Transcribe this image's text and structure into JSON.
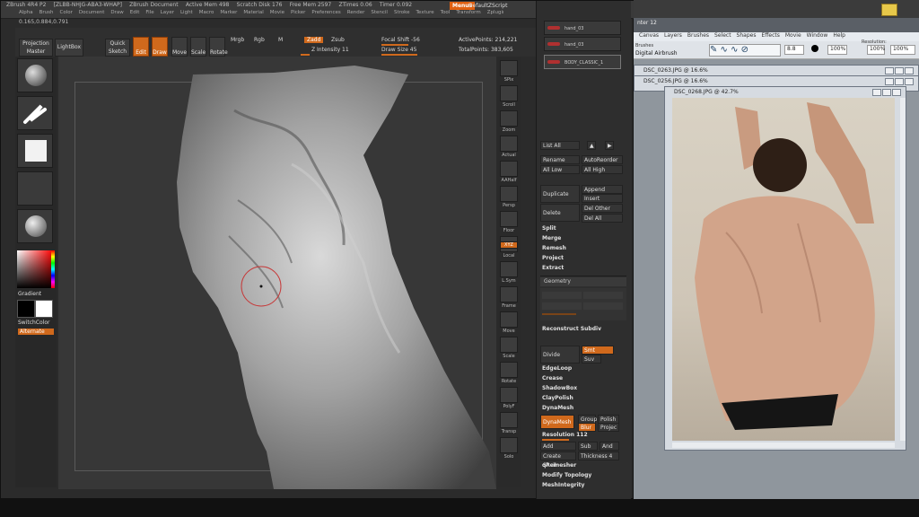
{
  "zbrush": {
    "title_bar": {
      "app": "ZBrush 4R4 P2",
      "id": "[ZLBB-NHJG-ABA3-WHAP]",
      "doc": "ZBrush Document",
      "active_mem": "Active Mem 498",
      "scratch": "Scratch Disk 176",
      "free_mem": "Free Mem 2597",
      "ztimes": "ZTimes 0.06",
      "timer": "Timer 0.092",
      "memo": "Menus",
      "script": "DefaultZScript"
    },
    "menus": [
      "Alpha",
      "Brush",
      "Color",
      "Document",
      "Draw",
      "Edit",
      "File",
      "Layer",
      "Light",
      "Macro",
      "Marker",
      "Material",
      "Movie",
      "Picker",
      "Preferences",
      "Render",
      "Stencil",
      "Stroke",
      "Texture",
      "Tool",
      "Transform",
      "Zplugin",
      "Zscript"
    ],
    "coords": "0.165,0.884,0.791",
    "toolbar": {
      "projection_master": "Projection Master",
      "lightbox": "LightBox",
      "quick_sketch": "Quick Sketch",
      "edit": "Edit",
      "draw": "Draw",
      "move": "Move",
      "scale": "Scale",
      "rotate": "Rotate",
      "mrgb": "Mrgb",
      "rgb": "Rgb",
      "m": "M",
      "zadd": "Zadd",
      "zsub": "Zsub",
      "z_intensity": "Z Intensity 11",
      "focal_shift": "Focal Shift -56",
      "draw_size": "Draw Size 45",
      "active_points": "ActivePoints: 214,221",
      "total_points": "TotalPoints: 383,605"
    },
    "left": {
      "gradient": "Gradient",
      "switch_color": "SwitchColor",
      "alternate": "Alternate"
    },
    "shelf": [
      "SPix",
      "Scroll",
      "Zoom",
      "Actual",
      "AAHalf",
      "Persp",
      "Floor",
      "Local",
      "L.Sym",
      "Frame",
      "Move",
      "Scale",
      "Rotate",
      "PolyF",
      "Transp",
      "Solo"
    ],
    "shelf_xyz": "XYZ",
    "subtools": [
      {
        "label": "hand_03"
      },
      {
        "label": "hand_03"
      },
      {
        "label": "BODY_CLASSIC_1"
      }
    ],
    "tray": {
      "list_all": "List All",
      "rename": "Rename",
      "auto_reorder": "AutoReorder",
      "all_low": "All Low",
      "all_high": "All High",
      "duplicate": "Duplicate",
      "append": "Append",
      "insert": "Insert",
      "delete": "Delete",
      "del_other": "Del Other",
      "del_all": "Del All",
      "split": "Split",
      "merge": "Merge",
      "remesh": "Remesh",
      "project": "Project",
      "extract": "Extract",
      "geometry": "Geometry",
      "reconstruct_subdiv": "Reconstruct Subdiv",
      "divide": "Divide",
      "smt": "Smt",
      "suv": "Suv",
      "edge_loop": "EdgeLoop",
      "crease": "Crease",
      "shadowbox": "ShadowBox",
      "claypolish": "ClayPolish",
      "dynamesh_title": "DynaMesh",
      "dynamesh_btn": "DynaMesh",
      "group": "Group",
      "polish": "Polish",
      "blur": "Blur",
      "projec": "Projec",
      "resolution": "Resolution 112",
      "add": "Add",
      "sub": "Sub",
      "and": "And",
      "create_shell": "Create Shell",
      "thickness": "Thickness 4",
      "qremesher": "qRemesher",
      "modify_topology": "Modify Topology",
      "meshintegrity": "MeshIntegrity"
    }
  },
  "photoshop": {
    "menus": [
      "Canvas",
      "Layers",
      "Brushes",
      "Select",
      "Shapes",
      "Effects",
      "Movie",
      "Window",
      "Help"
    ],
    "brush_label": "Brushes",
    "brush_name": "Digital Airbrush",
    "opacity1": "100%",
    "opacity2": "100%",
    "resolution_label": "Resolution:",
    "resolution_val": "100%",
    "size_val": "8.8",
    "doc1": "DSC_0263.JPG @ 16.6%",
    "doc2": "DSC_0256.JPG @ 16.6%",
    "doc3": "DSC_0268.JPG @ 42.7%",
    "app_tail": "nter 12"
  }
}
